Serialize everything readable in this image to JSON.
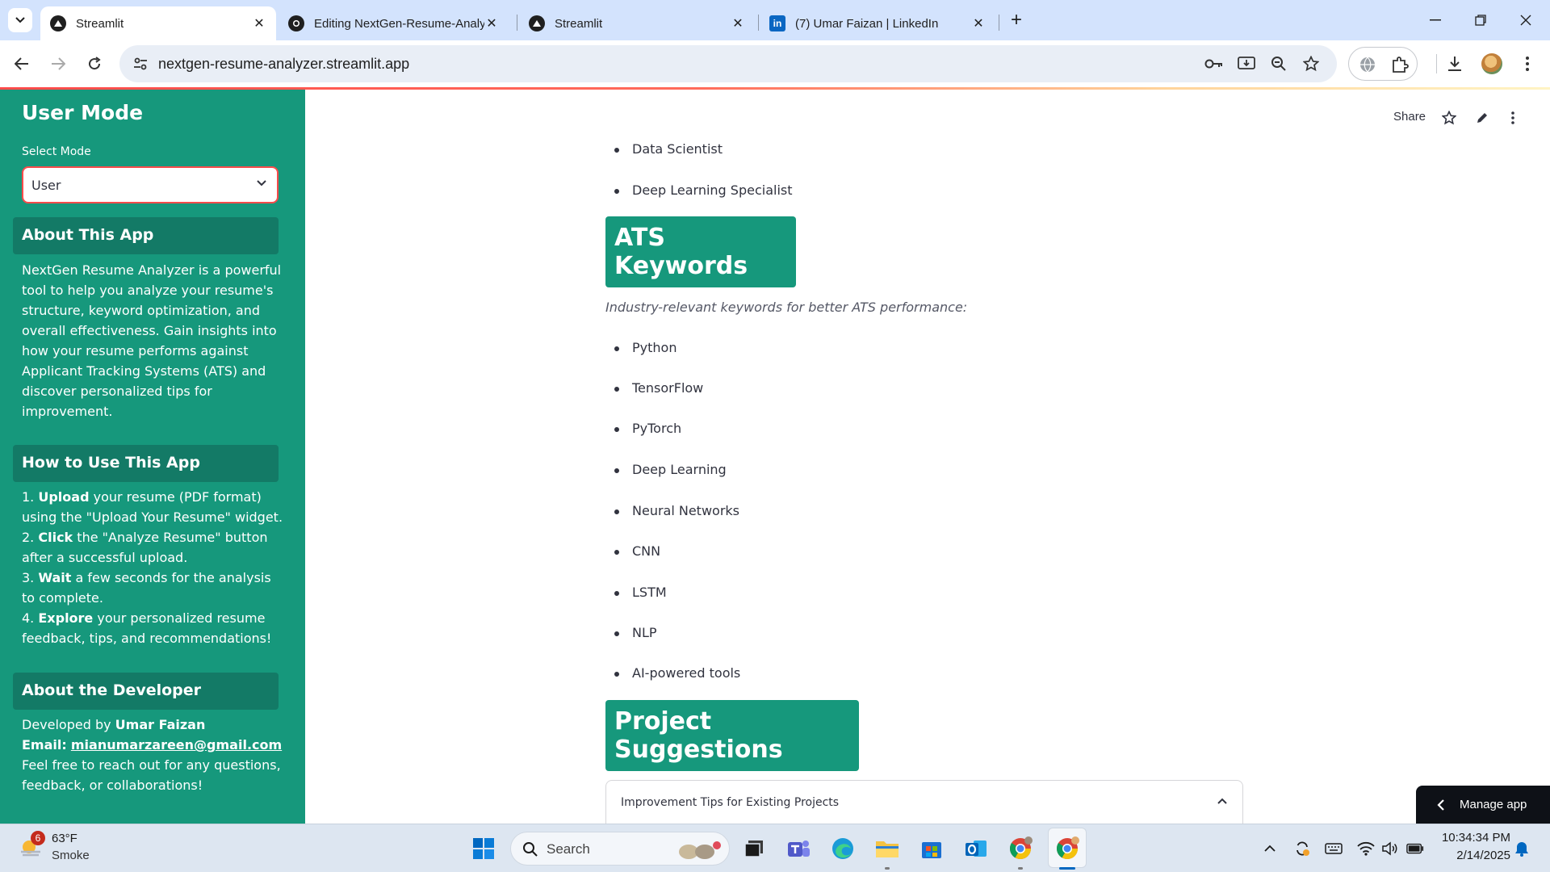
{
  "browser": {
    "tabs": [
      {
        "title": "Streamlit",
        "icon": "streamlit-icon",
        "active": true
      },
      {
        "title": "Editing NextGen-Resume-Analy",
        "icon": "github-icon",
        "active": false
      },
      {
        "title": "Streamlit",
        "icon": "streamlit-icon",
        "active": false
      },
      {
        "title": "(7) Umar Faizan | LinkedIn",
        "icon": "linkedin-icon",
        "active": false
      }
    ],
    "url": "nextgen-resume-analyzer.streamlit.app"
  },
  "sidebar": {
    "title": "User Mode",
    "select_label": "Select Mode",
    "select_value": "User",
    "about_heading": "About This App",
    "about_text": "NextGen Resume Analyzer is a powerful tool to help you analyze your resume's structure, keyword optimization, and overall effectiveness. Gain insights into how your resume performs against Applicant Tracking Systems (ATS) and discover personalized tips for improvement.",
    "howto_heading": "How to Use This App",
    "steps": [
      {
        "num": "1.",
        "bold": "Upload",
        "text": " your resume (PDF format) using the \"Upload Your Resume\" widget."
      },
      {
        "num": "2.",
        "bold": "Click",
        "text": " the \"Analyze Resume\" button after a successful upload."
      },
      {
        "num": "3.",
        "bold": "Wait",
        "text": " a few seconds for the analysis to complete."
      },
      {
        "num": "4.",
        "bold": "Explore",
        "text": " your personalized resume feedback, tips, and recommendations!"
      }
    ],
    "dev_heading": "About the Developer",
    "dev_prefix": "Developed by ",
    "dev_name": "Umar Faizan",
    "email_label": "Email:",
    "email": "mianumarzareen@gmail.com",
    "dev_note": "Feel free to reach out for any questions, feedback, or collaborations!"
  },
  "main": {
    "share_label": "Share",
    "roles": [
      "Data Scientist",
      "Deep Learning Specialist"
    ],
    "ats_heading": "ATS Keywords",
    "ats_subtitle": "Industry-relevant keywords for better ATS performance:",
    "keywords": [
      "Python",
      "TensorFlow",
      "PyTorch",
      "Deep Learning",
      "Neural Networks",
      "CNN",
      "LSTM",
      "NLP",
      "AI-powered tools"
    ],
    "projects_heading": "Project Suggestions",
    "expander_label": "Improvement Tips for Existing Projects",
    "manage_app": "Manage app"
  },
  "taskbar": {
    "weather_badge": "6",
    "temperature": "63°F",
    "condition": "Smoke",
    "search_label": "Search",
    "time": "10:34:34 PM",
    "date": "2/14/2025"
  },
  "colors": {
    "accent": "#16987c",
    "heading_bg": "#137a66",
    "select_border": "#ff4b4b"
  }
}
